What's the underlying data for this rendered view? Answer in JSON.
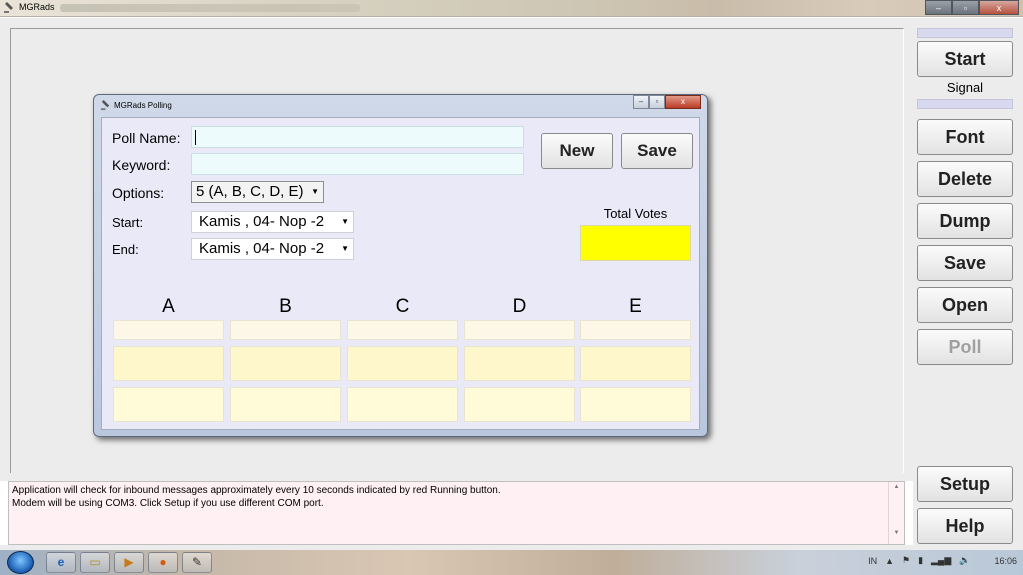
{
  "window": {
    "title": "MGRads",
    "controls": {
      "minimize": "–",
      "maximize": "▫",
      "close": "x"
    }
  },
  "sidebar": {
    "start": "Start",
    "signal_label": "Signal",
    "font": "Font",
    "delete": "Delete",
    "dump": "Dump",
    "save": "Save",
    "open": "Open",
    "poll": "Poll",
    "setup": "Setup",
    "help": "Help"
  },
  "dialog": {
    "title": "MGRads Polling",
    "poll_name_label": "Poll Name:",
    "poll_name_value": "",
    "keyword_label": "Keyword:",
    "keyword_value": "",
    "options_label": "Options:",
    "options_value": "5 (A, B, C, D, E)",
    "start_label": "Start:",
    "start_value": "Kamis , 04- Nop -2",
    "end_label": "End:",
    "end_value": "Kamis , 04- Nop -2",
    "new_button": "New",
    "save_button": "Save",
    "total_votes_label": "Total Votes",
    "columns": [
      "A",
      "B",
      "C",
      "D",
      "E"
    ],
    "accent_total": "#ffff00"
  },
  "messages": {
    "line1": "Application will check for inbound messages approximately every 10 seconds indicated by red Running button.",
    "line2": "Modem will be using COM3.  Click Setup if you use different COM port."
  },
  "taskbar": {
    "lang": "IN",
    "clock": "16:06"
  }
}
